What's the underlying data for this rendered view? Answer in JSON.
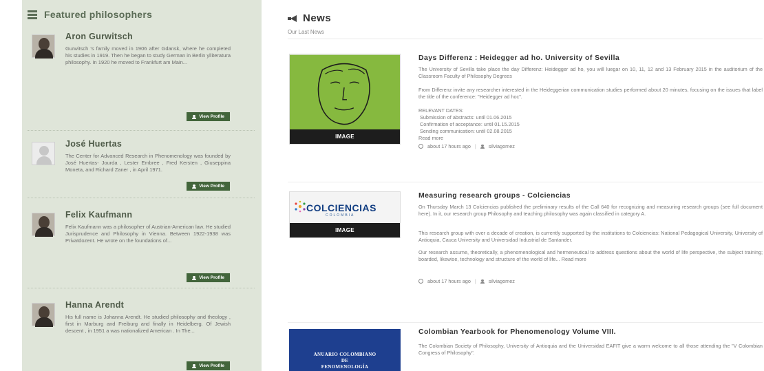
{
  "sidebar": {
    "title": "Featured philosophers",
    "view_profile_label": "View Profile",
    "items": [
      {
        "name": "Aron Gurwitsch",
        "bio": "Gurwitsch 's family moved in 1906 after Gdansk, where he completed his studies in 1919. Then he began to study German in Berlin ylliteratura philosophy. In 1920 he moved to Frankfurt am Main..."
      },
      {
        "name": "José Huertas",
        "bio": "The Center for Advanced Research in Phenomenology was founded by José Huertas- Jourda , Lester Embree , Fred Kersten , Giuseppina Moneta, and Richard Zaner , in April 1971."
      },
      {
        "name": "Felix Kaufmann",
        "bio": "Felix Kaufmann was a philosopher of Austrian-American law. He studied Jurisprudence and Philosophy in Vienna. Between 1922-1938 was Privatdozent. He wrote on the foundations of..."
      },
      {
        "name": "Hanna Arendt",
        "bio": "His full name is Johanna Arendt. He studied philosophy and theology , first in Marburg and Freiburg and finally in Heidelberg. Of Jewish descent , in 1951 a was nationalized American . In The..."
      }
    ]
  },
  "news": {
    "title": "News",
    "subtitle": "Our Last News",
    "image_label": "IMAGE",
    "articles": [
      {
        "title": "Days Differenz : Heidegger ad ho. University of Sevilla",
        "body": "The University of Sevilla take place the day Differenz: Heidegger ad ho, you will luegar on 10, 11, 12 and 13 February 2015 in the auditorium of the Classroom Faculty of Philosophy Degrees",
        "body2": "From Differenz invite any researcher interested in the Heideggerian communication studies performed about 20 minutes, focusing on the issues that label the title of the conference: \"Heidegger ad hoc\".",
        "dates_heading": "RELEVANT DATES:",
        "dates": [
          "Submission of abstracts: until 01.06.2015",
          "Confirmation of acceptance: until 01.15.2015",
          "Sending communication: until 02.08.2015"
        ],
        "read_more": "Read more",
        "time": "about 17 hours ago",
        "author": "silviagomez"
      },
      {
        "title": "Measuring research groups - Colciencias",
        "body": "On Thursday March 13 Colciencias published the preliminary results of the Call 640 for recognizing and measuring research groups (see full document here). In it, our research group Philosophy and teaching philosophy was again classified in category A.",
        "body2": "This research group with over a decade of creation, is currently supported by the institutions to Colciencias: National Pedagogical University, University of Antioquia, Cauca University and Universidad Industrial de Santander.",
        "body3": "Our research assume, theoretically, a phenomenological and hermeneutical to address questions about the world of life perspective, the subject training; boarded, likewise, technology and structure of the world of life...",
        "read_more": "Read more",
        "time": "about 17 hours ago",
        "author": "silviagomez",
        "logo_text": "COLCIENCIAS",
        "logo_sub": "COLOMBIA"
      },
      {
        "title": "Colombian Yearbook for Phenomenology Volume VIII.",
        "body": "The Colombian Society of Philosophy, University of Antioquia and the Universidad EAFIT give a warm welcome to all those attending the \"V Colombian Congress of Philosophy\".",
        "cover_line1": "ANUARIO COLOMBIANO",
        "cover_line2": "DE",
        "cover_line3": "FENOMENOLOGÍA"
      }
    ]
  },
  "colors": {
    "sidebar_bg": "#dfe5d9",
    "button_green": "#42653b",
    "thumb_green": "#86b93f",
    "yearbook_blue": "#1e3f8f"
  }
}
